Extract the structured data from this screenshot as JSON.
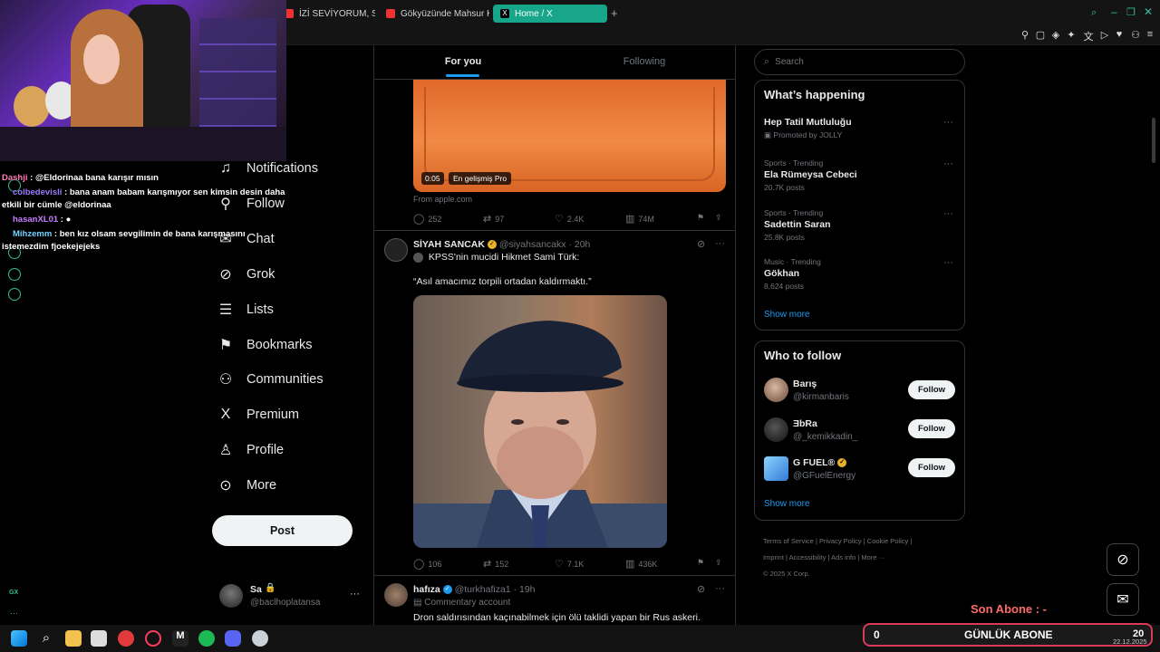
{
  "browser": {
    "tabs": [
      {
        "label": "İZİ SEVİYORUM, SİZİ SE",
        "active": false
      },
      {
        "label": "Gökyüzünde Mahsur Kal",
        "active": false
      },
      {
        "label": "Home / X",
        "active": true
      }
    ],
    "new_tab": "+"
  },
  "overlay": {
    "chat": [
      {
        "user": "Dashji",
        "message": "@Eldorinaa bana karışır mısın",
        "color": "#ff7ab8"
      },
      {
        "user": "colbedevisli",
        "message": "bana anam babam karışmıyor sen kimsin desin daha etkili bir cümle @eldorinaa",
        "color": "#9b7bff"
      },
      {
        "user": "hasanXL01",
        "message": "",
        "color": "#c77dff"
      },
      {
        "user": "Mihzemm",
        "message": "ben kız olsam sevgilimin de bana karışmasını istemezdim fjoekejejeks",
        "color": "#6fd3ff"
      }
    ],
    "rail_label": "GX",
    "sub_label": "Son Abone : -",
    "daily_sub_count": "0",
    "daily_sub_label": "GÜNLÜK ABONE",
    "daily_sub_right": "20"
  },
  "nav": {
    "items": [
      {
        "label": "Notifications",
        "icon": "bell-icon"
      },
      {
        "label": "Follow",
        "icon": "add-user-icon"
      },
      {
        "label": "Chat",
        "icon": "chat-icon"
      },
      {
        "label": "Grok",
        "icon": "grok-icon"
      },
      {
        "label": "Lists",
        "icon": "list-icon"
      },
      {
        "label": "Bookmarks",
        "icon": "bookmark-icon"
      },
      {
        "label": "Communities",
        "icon": "communities-icon"
      },
      {
        "label": "Premium",
        "icon": "x-logo-icon"
      },
      {
        "label": "Profile",
        "icon": "profile-icon"
      },
      {
        "label": "More",
        "icon": "more-circle-icon"
      }
    ],
    "post_label": "Post",
    "account": {
      "name": "Sa",
      "handle": "@baclhoplatansa"
    }
  },
  "feed": {
    "tabs": [
      "For you",
      "Following"
    ],
    "video": {
      "time": "0:05",
      "caption": "En gelişmiş Pro",
      "source": "From apple.com"
    },
    "post1_stats": {
      "replies": "252",
      "reposts": "97",
      "likes": "2.4K",
      "views": "74M"
    },
    "post2": {
      "name": "SİYAH SANCAK",
      "handle": "@siyahsancakx",
      "time": "20h",
      "line1": "KPSS'nin mucidi Hikmet Sami Türk:",
      "line2": "“Asıl amacımız torpili ortadan kaldırmaktı.”",
      "stats": {
        "replies": "106",
        "reposts": "152",
        "likes": "7.1K",
        "views": "436K"
      }
    },
    "post3": {
      "name": "hafıza",
      "handle": "@turkhafiza1",
      "time": "19h",
      "badge": "Commentary account",
      "text": "Dron saldırısından kaçınabilmek için ölü taklidi yapan bir Rus askeri."
    }
  },
  "sidebar": {
    "search_placeholder": "Search",
    "happening_title": "What’s happening",
    "trends": [
      {
        "meta": "Promoted by JOLLY",
        "name": "Hep Tatil Mutluluğu",
        "promoted": true
      },
      {
        "meta": "Sports · Trending",
        "name": "Ela Rümeysa Cebeci",
        "count": "20.7K posts"
      },
      {
        "meta": "Sports · Trending",
        "name": "Sadettin Saran",
        "count": "25.8K posts"
      },
      {
        "meta": "Music · Trending",
        "name": "Gökhan",
        "count": "8,624 posts"
      }
    ],
    "show_more": "Show more",
    "who_to_follow": "Who to follow",
    "suggestions": [
      {
        "name": "Barış",
        "handle": "@kirmanbaris"
      },
      {
        "name": "ƎbRa",
        "handle": "@_kemikkadin_"
      },
      {
        "name": "G FUEL®",
        "handle": "@GFuelEnergy"
      }
    ],
    "follow_label": "Follow",
    "footer": [
      "Terms of Service",
      "Privacy Policy",
      "Cookie Policy",
      "Imprint",
      "Accessibility",
      "Ads info",
      "More ···",
      "© 2025 X Corp."
    ]
  },
  "taskbar": {
    "date": "22.12.2025"
  }
}
